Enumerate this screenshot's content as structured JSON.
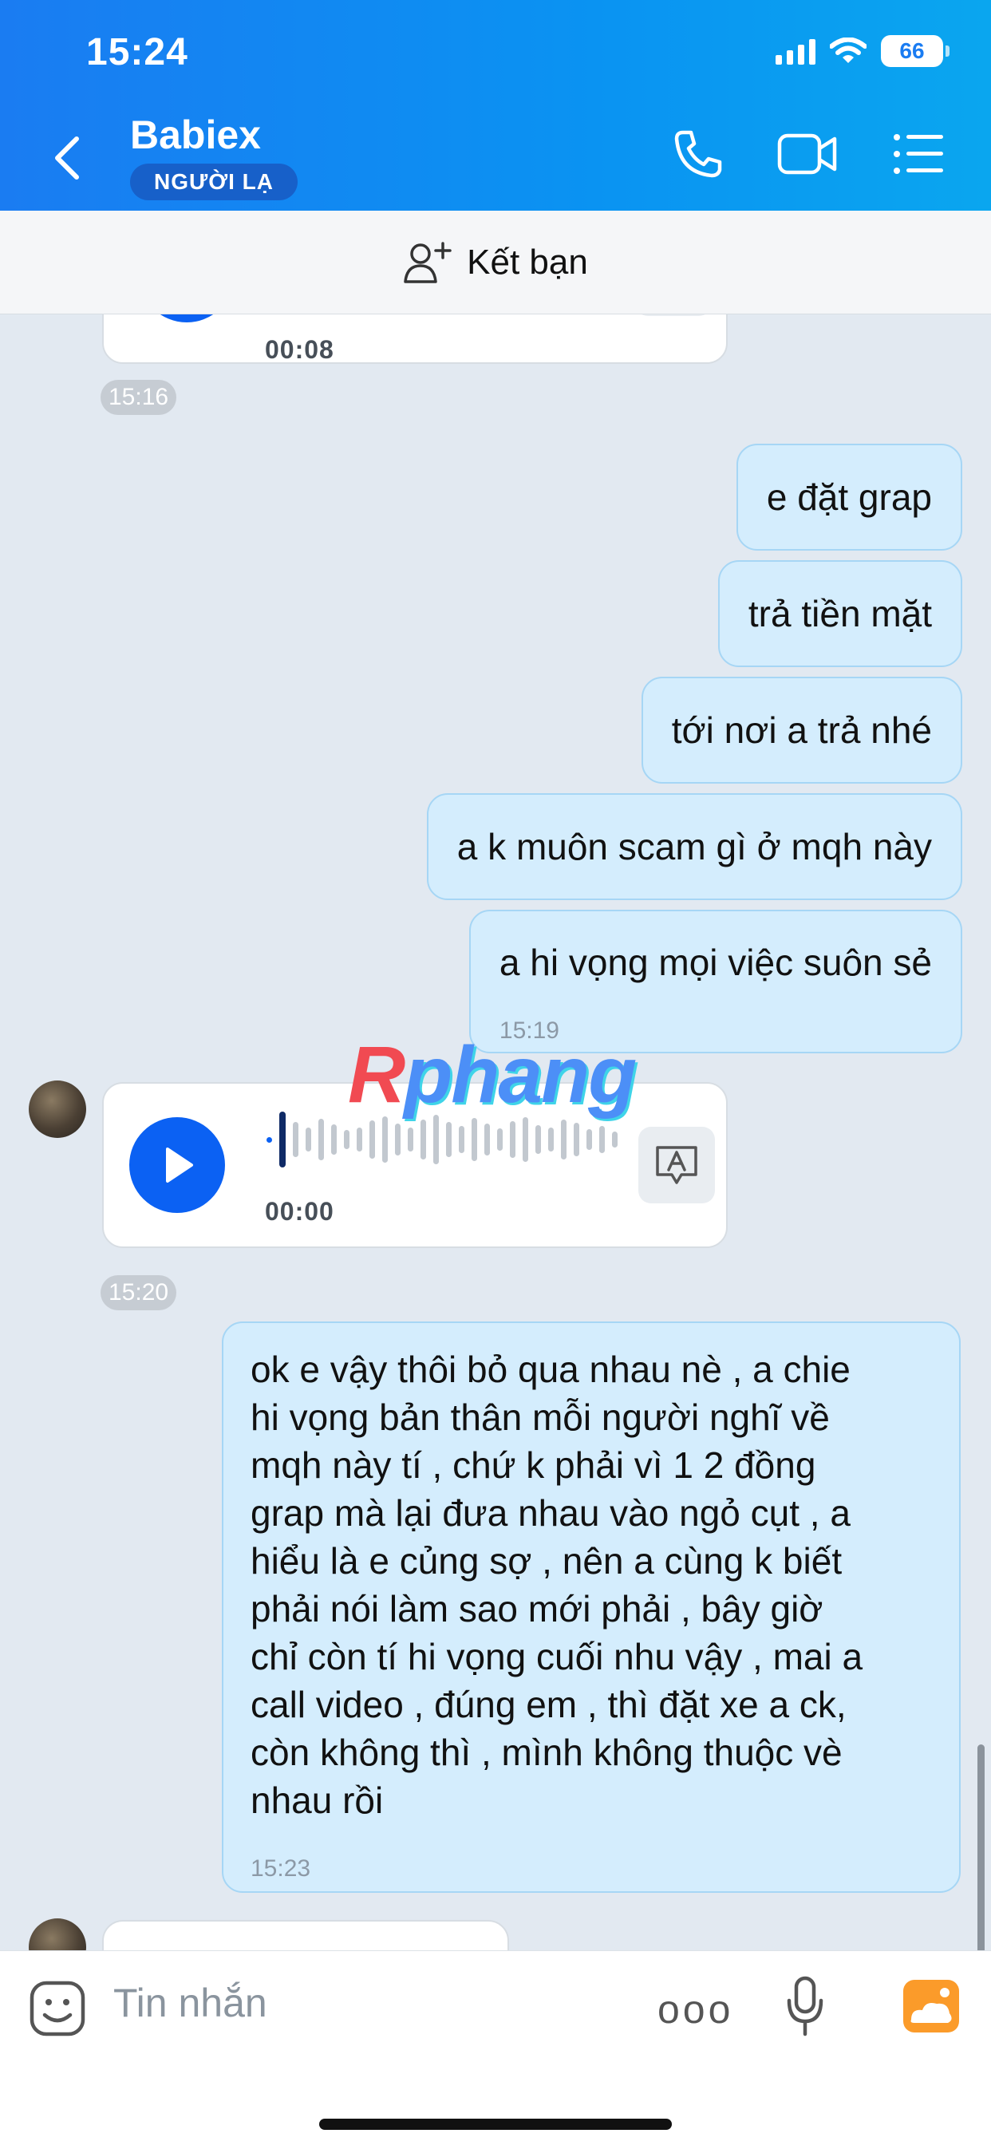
{
  "status_bar": {
    "time": "15:24",
    "battery": "66"
  },
  "header": {
    "contact_name": "Babiex",
    "badge": "NGƯỜI LẠ",
    "icons": [
      "back-icon",
      "phone-icon",
      "video-call-icon",
      "menu-list-icon"
    ]
  },
  "add_friend": {
    "label": "Kết bạn",
    "icon": "add-user-icon"
  },
  "messages": {
    "voice_top": {
      "duration": "00:08",
      "time": "15:16"
    },
    "out": [
      {
        "text": "e đặt grap"
      },
      {
        "text": "trả tiền mặt"
      },
      {
        "text": "tới nơi a trả nhé"
      },
      {
        "text": "a k muôn scam gì ở mqh này"
      },
      {
        "text": "a hi vọng mọi việc suôn sẻ",
        "time": "15:19"
      }
    ],
    "voice_mid": {
      "duration": "00:00",
      "time": "15:20",
      "progress": 0
    },
    "long": {
      "lines": [
        "ok e vậy thôi bỏ qua nhau nè , a chie",
        "hi vọng bản thân mỗi người nghĩ về",
        "mqh này tí , chứ k phải vì 1 2 đồng",
        "grap mà lại đưa nhau vào ngỏ cụt , a",
        "hiểu là e củng sợ , nên a cùng k biết",
        "phải nói làm sao mới phải , bây giờ",
        "chỉ còn tí hi vọng cuối nhu vậy , mai a",
        "call video , đúng em , thì đặt xe  a ck,",
        "còn không thì , mình không thuộc vè",
        "nhau rồi"
      ],
      "time": "15:23"
    }
  },
  "watermark": {
    "first": "R",
    "rest": "phang"
  },
  "input_bar": {
    "placeholder": "Tin nhắn",
    "more": "ooo"
  },
  "colors": {
    "header": "#1a7cf2",
    "out_bubble": "#d4edfd",
    "play": "#0b61f3"
  }
}
